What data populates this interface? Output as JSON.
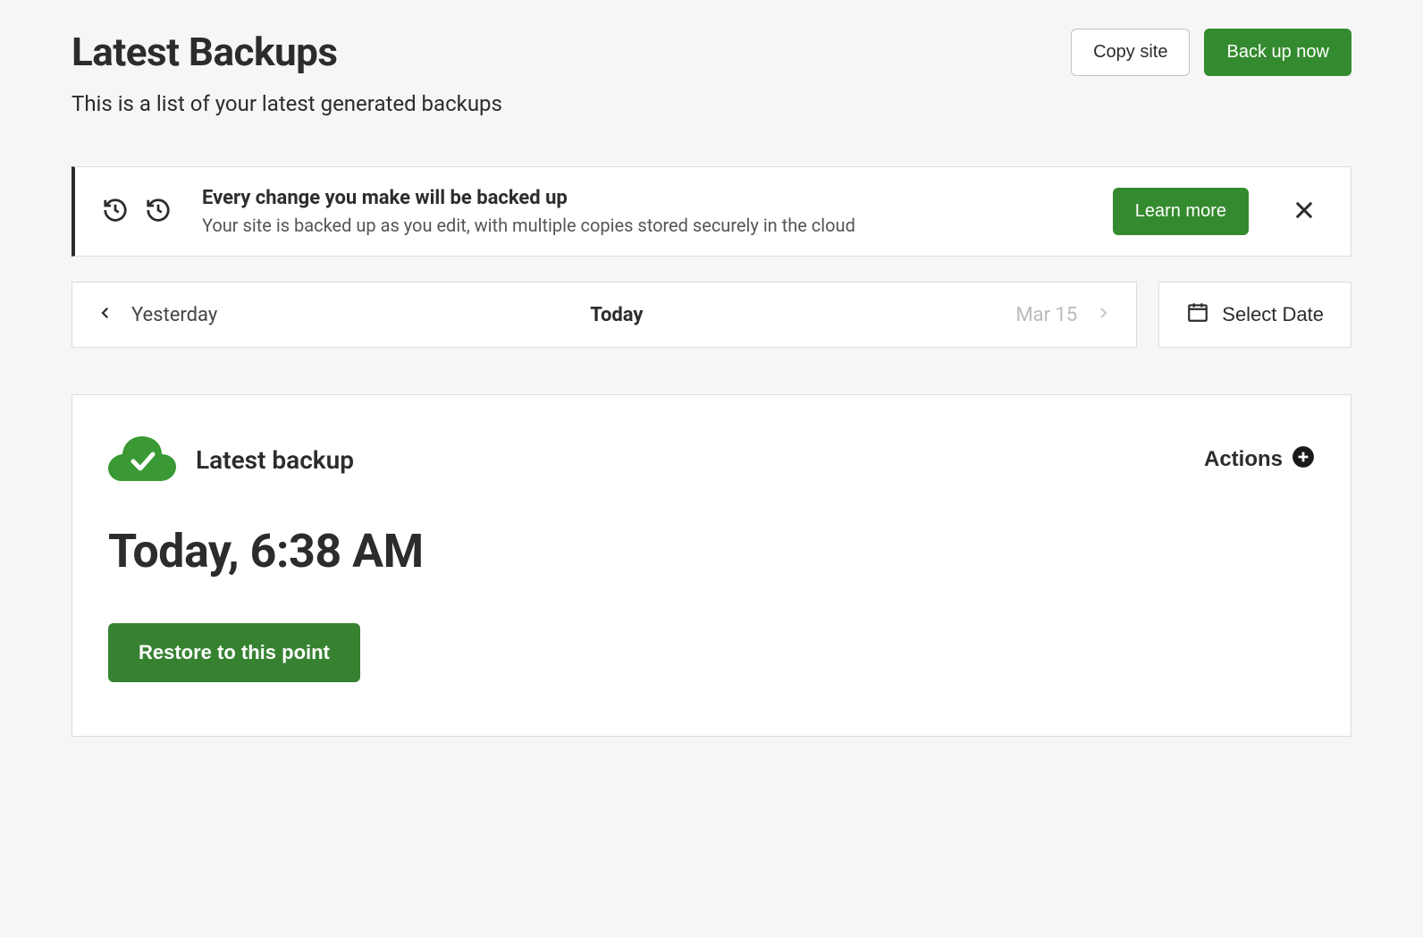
{
  "header": {
    "title": "Latest Backups",
    "subtitle": "This is a list of your latest generated backups",
    "copy_site_label": "Copy site",
    "backup_now_label": "Back up now"
  },
  "banner": {
    "title": "Every change you make will be backed up",
    "description": "Your site is backed up as you edit, with multiple copies stored securely in the cloud",
    "learn_more_label": "Learn more"
  },
  "date_nav": {
    "prev_label": "Yesterday",
    "current_label": "Today",
    "next_label": "Mar 15",
    "select_date_label": "Select Date"
  },
  "backup_card": {
    "title": "Latest backup",
    "actions_label": "Actions",
    "timestamp": "Today, 6:38 AM",
    "restore_label": "Restore to this point"
  },
  "colors": {
    "green": "#348a2e"
  }
}
